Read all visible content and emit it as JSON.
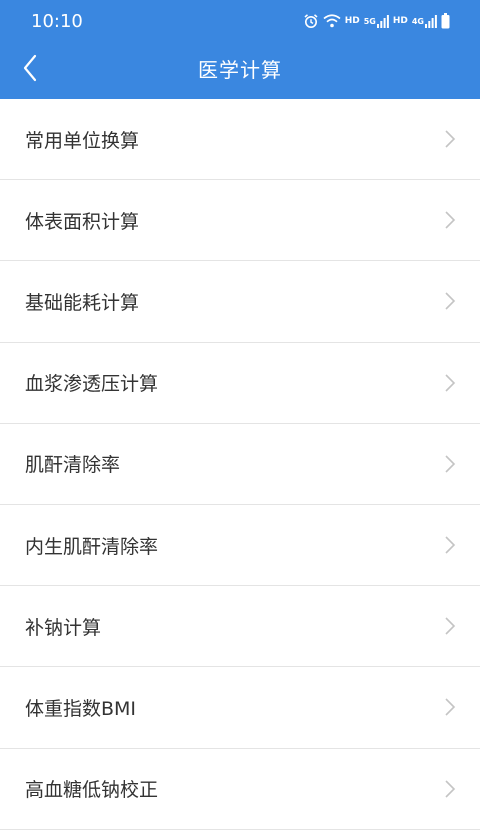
{
  "status": {
    "time": "10:10",
    "hd1": "HD",
    "net1": "5G",
    "hd2": "HD",
    "net2": "4G"
  },
  "nav": {
    "title": "医学计算"
  },
  "items": [
    {
      "label": "常用单位换算"
    },
    {
      "label": "体表面积计算"
    },
    {
      "label": "基础能耗计算"
    },
    {
      "label": "血浆渗透压计算"
    },
    {
      "label": "肌酐清除率"
    },
    {
      "label": "内生肌酐清除率"
    },
    {
      "label": "补钠计算"
    },
    {
      "label": "体重指数BMI"
    },
    {
      "label": "高血糖低钠校正"
    }
  ],
  "colors": {
    "header": "#3a87e0",
    "text": "#333333",
    "divider": "#e4e4e4",
    "chevron": "#c4c4c4"
  },
  "icons": {
    "back": "chevron-left-icon",
    "row": "chevron-right-icon",
    "status": [
      "alarm-icon",
      "wifi-icon",
      "signal-icon",
      "battery-icon"
    ]
  }
}
